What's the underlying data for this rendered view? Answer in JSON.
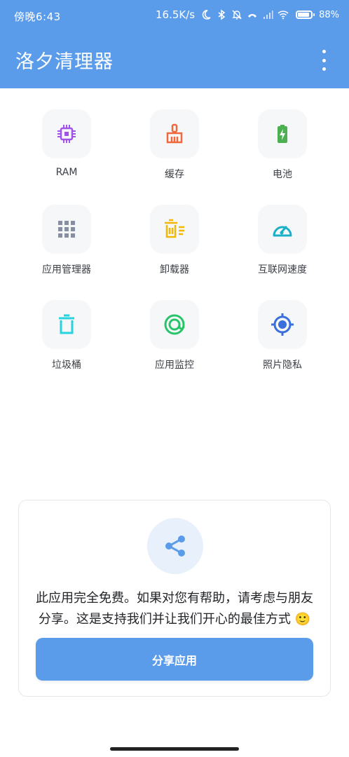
{
  "status_bar": {
    "time": "傍晚6:43",
    "speed": "16.5K/s",
    "battery": "88%",
    "battery_level": 0.88
  },
  "header": {
    "title": "洛夕清理器",
    "menu_icon": "more-vert-icon"
  },
  "tiles": [
    {
      "label": "RAM",
      "icon": "chip-icon",
      "color": "#a154e6"
    },
    {
      "label": "缓存",
      "icon": "broom-icon",
      "color": "#ee6a3d"
    },
    {
      "label": "电池",
      "icon": "battery-icon",
      "color": "#4caf50"
    },
    {
      "label": "应用管理器",
      "icon": "grid-icon",
      "color": "#8790a3"
    },
    {
      "label": "卸载器",
      "icon": "trash-list-icon",
      "color": "#f2b705"
    },
    {
      "label": "互联网速度",
      "icon": "speedometer-icon",
      "color": "#1bb0c6"
    },
    {
      "label": "垃圾桶",
      "icon": "trash-icon",
      "color": "#26d4e0"
    },
    {
      "label": "应用监控",
      "icon": "monitor-icon",
      "color": "#27c46a"
    },
    {
      "label": "照片隐私",
      "icon": "target-icon",
      "color": "#3a6fdc"
    }
  ],
  "share_card": {
    "message": "此应用完全免费。如果对您有帮助，请考虑与朋友分享。这是支持我们并让我们开心的最佳方式 🙂",
    "button_label": "分享应用",
    "icon": "share-icon",
    "accent": "#5b9cea"
  }
}
